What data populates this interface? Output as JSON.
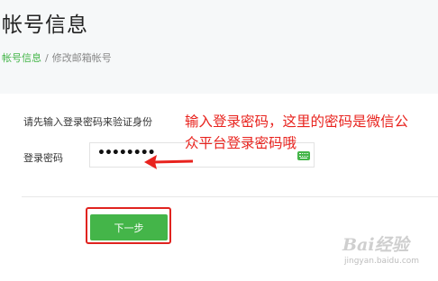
{
  "page": {
    "title": "帐号信息"
  },
  "breadcrumb": {
    "link": "帐号信息",
    "separator": "/",
    "current": "修改邮箱帐号"
  },
  "form": {
    "prompt": "请先输入登录密码来验证身份",
    "password_label": "登录密码",
    "password_value": "••••••••",
    "next_label": "下一步"
  },
  "annotation": {
    "text": "输入登录密码，这里的密码是微信公众平台登录密码哦"
  },
  "watermark": {
    "brand": "Bai经验",
    "site": "jingyan.baidu.com"
  },
  "colors": {
    "accent": "#44b549",
    "annotation": "#e8231e",
    "background_top": "#f6f8f9"
  }
}
